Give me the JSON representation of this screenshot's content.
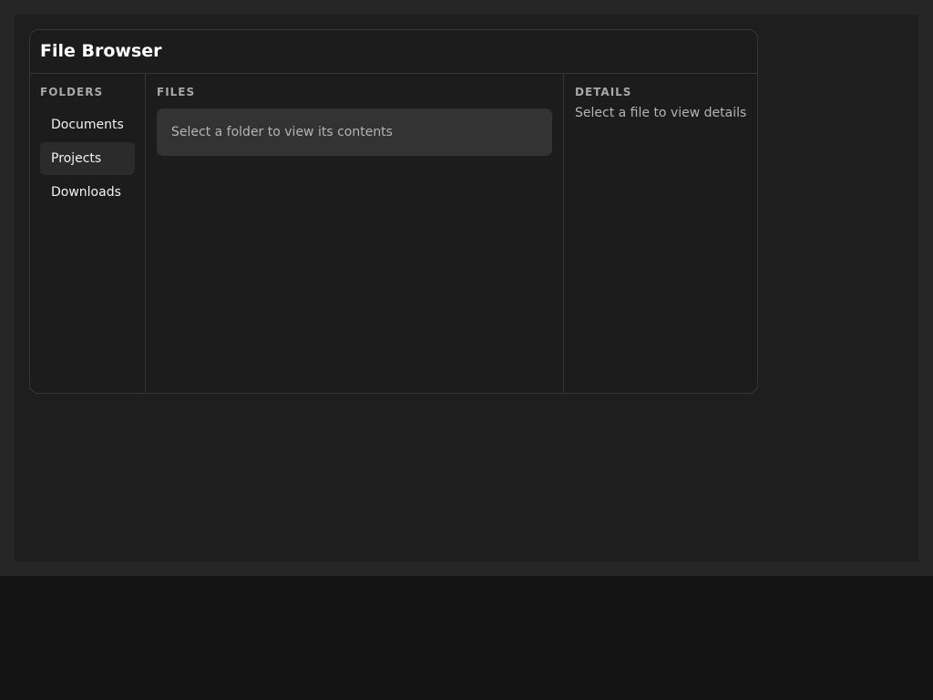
{
  "app": {
    "title": "File Browser"
  },
  "folders": {
    "label": "FOLDERS",
    "items": [
      {
        "label": "Documents",
        "selected": false
      },
      {
        "label": "Projects",
        "selected": true
      },
      {
        "label": "Downloads",
        "selected": false
      }
    ]
  },
  "files": {
    "label": "FILES",
    "empty_message": "Select a folder to view its contents"
  },
  "details": {
    "label": "DETAILS",
    "empty_message": "Select a file to view details"
  },
  "colors": {
    "page_background": "#141414",
    "panel_background": "#1c1c1c",
    "border": "#363636",
    "selected_item": "#2b2b2b",
    "empty_state": "#333333"
  }
}
